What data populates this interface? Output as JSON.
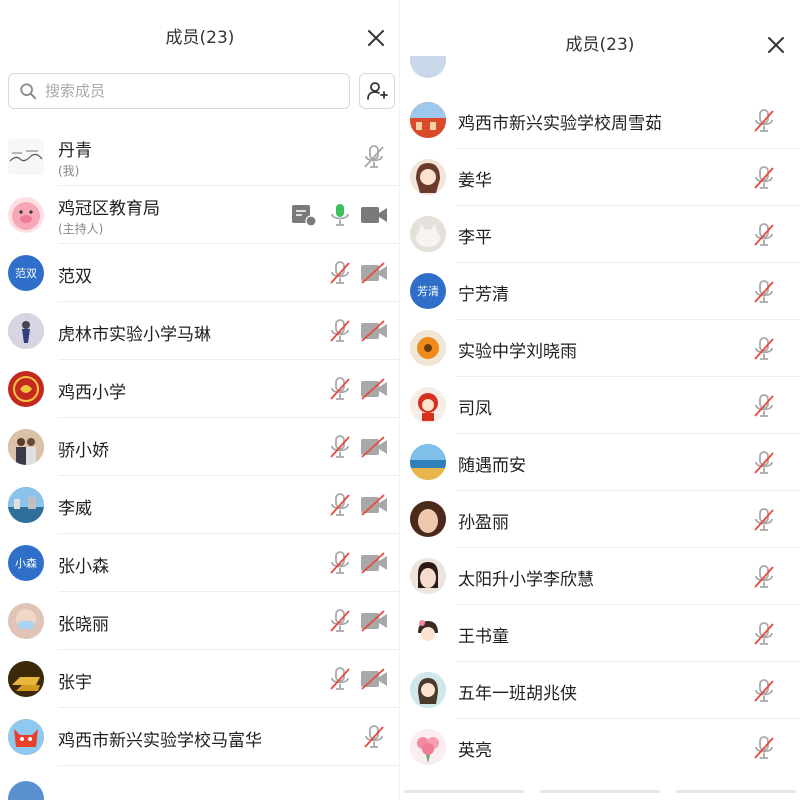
{
  "left_panel": {
    "title": "成员(23)",
    "search_placeholder": "搜索成员",
    "members": [
      {
        "name": "丹青",
        "sub": "(我)",
        "avatar": "landscape-painting",
        "mic": "muted-gray",
        "cam": "none"
      },
      {
        "name": "鸡冠区教育局",
        "sub": "(主持人)",
        "avatar": "pink-pig",
        "mic": "active-green",
        "cam": "on",
        "share": true
      },
      {
        "name": "范双",
        "avatar_text": "范双",
        "avatar": "initials",
        "mic": "muted",
        "cam": "off"
      },
      {
        "name": "虎林市实验小学马琳",
        "avatar": "figure-photo",
        "mic": "muted",
        "cam": "off"
      },
      {
        "name": "鸡西小学",
        "avatar": "red-emblem",
        "mic": "muted",
        "cam": "off"
      },
      {
        "name": "骄小娇",
        "avatar": "couple-photo",
        "mic": "muted",
        "cam": "off"
      },
      {
        "name": "李威",
        "avatar": "waterfront-photo",
        "mic": "muted",
        "cam": "off"
      },
      {
        "name": "张小森",
        "avatar_text": "小森",
        "avatar": "initials",
        "mic": "muted",
        "cam": "off"
      },
      {
        "name": "张晓丽",
        "avatar": "masked-face",
        "mic": "muted",
        "cam": "off"
      },
      {
        "name": "张宇",
        "avatar": "gold-bars",
        "mic": "muted",
        "cam": "off"
      },
      {
        "name": "鸡西市新兴实验学校马富华",
        "avatar": "red-fox-cartoon",
        "mic": "muted",
        "cam": "none"
      }
    ]
  },
  "right_panel": {
    "title": "成员(23)",
    "members": [
      {
        "name": "鸡西市新兴实验学校周雪茹",
        "avatar": "red-building-photo",
        "mic": "muted"
      },
      {
        "name": "姜华",
        "avatar": "anime-girl",
        "mic": "muted"
      },
      {
        "name": "李平",
        "avatar": "cat-photo",
        "mic": "muted"
      },
      {
        "name": "宁芳清",
        "avatar_text": "芳清",
        "avatar": "initials",
        "mic": "muted"
      },
      {
        "name": "实验中学刘晓雨",
        "avatar": "orange-flower",
        "mic": "muted"
      },
      {
        "name": "司凤",
        "avatar": "red-cartoon-doll",
        "mic": "muted"
      },
      {
        "name": "随遇而安",
        "avatar": "beach-photo",
        "mic": "muted"
      },
      {
        "name": "孙盈丽",
        "avatar": "woman-face",
        "mic": "muted"
      },
      {
        "name": "太阳升小学李欣慧",
        "avatar": "woman-face-light",
        "mic": "muted"
      },
      {
        "name": "王书童",
        "avatar": "cartoon-girl",
        "mic": "muted"
      },
      {
        "name": "五年一班胡兆侠",
        "avatar": "cartoon-girl-hair",
        "mic": "muted"
      },
      {
        "name": "英亮",
        "avatar": "pink-bouquet",
        "mic": "muted"
      }
    ]
  },
  "colors": {
    "muted_red": "#e84a3f",
    "icon_gray": "#a8a8a8",
    "active_green": "#3dbf5a",
    "initials_blue": "#2f6fc9",
    "divider": "#ededed"
  }
}
